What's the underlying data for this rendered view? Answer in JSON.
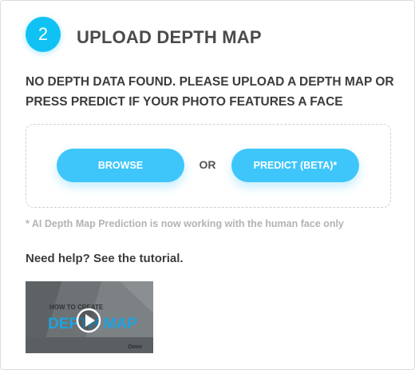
{
  "step": {
    "number": "2",
    "title": "UPLOAD DEPTH MAP"
  },
  "message": "NO DEPTH DATA FOUND. PLEASE UPLOAD A DEPTH MAP OR PRESS PREDICT IF YOUR PHOTO FEATURES A FACE",
  "upload": {
    "browse_label": "BROWSE",
    "or_label": "OR",
    "predict_label": "PREDICT (BETA)*"
  },
  "note": "* AI Depth Map Prediction is now working with the human face only",
  "help_text": "Need help? See the tutorial.",
  "video": {
    "line1": "HOW TO CREATE",
    "line2": "DEPTH MAP",
    "brand": "Omni",
    "icon": "play-icon"
  },
  "colors": {
    "accent": "#10c2f4",
    "button": "#3ec6fb",
    "text": "#3c3c3c",
    "note": "#b3b3b3"
  }
}
